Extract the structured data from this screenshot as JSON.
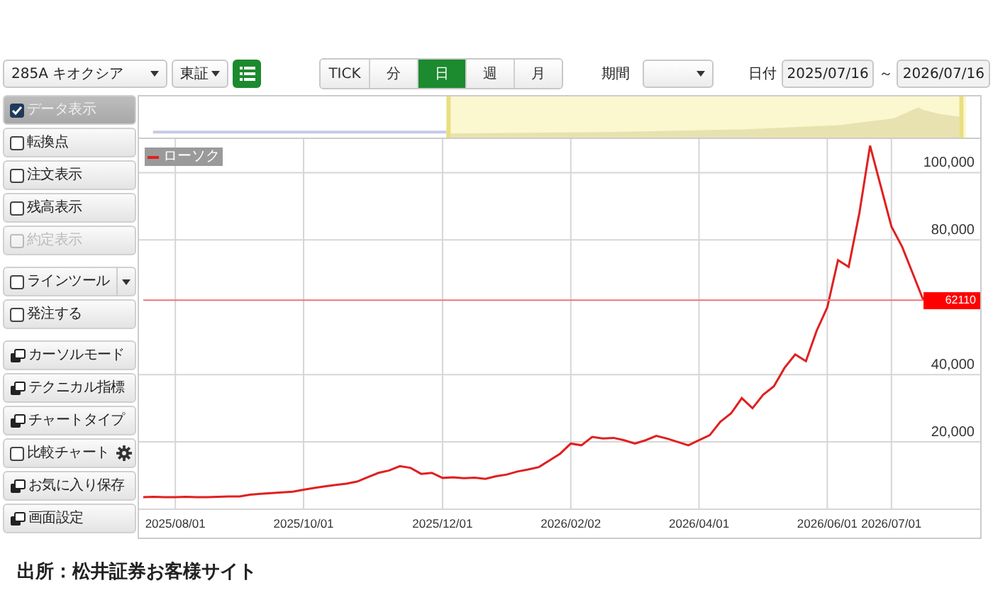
{
  "toolbar": {
    "symbol": "285A キオクシア",
    "market": "東証",
    "intervals": [
      {
        "label": "TICK",
        "selected": false
      },
      {
        "label": "分",
        "selected": false
      },
      {
        "label": "日",
        "selected": true
      },
      {
        "label": "週",
        "selected": false
      },
      {
        "label": "月",
        "selected": false
      }
    ],
    "period_label": "期間",
    "date_label": "日付",
    "date_from": "2025/07/16",
    "date_separator": "～",
    "date_to": "2026/07/16"
  },
  "sidebar": {
    "groups": [
      [
        {
          "kind": "checkbox",
          "label": "データ表示",
          "checked": true,
          "disabled": false,
          "dropdown": false,
          "settings": false
        },
        {
          "kind": "checkbox",
          "label": "転換点",
          "checked": false,
          "disabled": false,
          "dropdown": false,
          "settings": false
        },
        {
          "kind": "checkbox",
          "label": "注文表示",
          "checked": false,
          "disabled": false,
          "dropdown": false,
          "settings": false
        },
        {
          "kind": "checkbox",
          "label": "残高表示",
          "checked": false,
          "disabled": false,
          "dropdown": false,
          "settings": false
        },
        {
          "kind": "checkbox",
          "label": "約定表示",
          "checked": false,
          "disabled": true,
          "dropdown": false,
          "settings": false
        }
      ],
      [
        {
          "kind": "checkbox",
          "label": "ラインツール",
          "checked": false,
          "disabled": false,
          "dropdown": true,
          "settings": false
        },
        {
          "kind": "checkbox",
          "label": "発注する",
          "checked": false,
          "disabled": false,
          "dropdown": false,
          "settings": false
        }
      ],
      [
        {
          "kind": "menu",
          "label": "カーソルモード",
          "dropdown": false,
          "settings": false
        },
        {
          "kind": "menu",
          "label": "テクニカル指標",
          "dropdown": false,
          "settings": false
        },
        {
          "kind": "menu",
          "label": "チャートタイプ",
          "dropdown": false,
          "settings": false
        },
        {
          "kind": "checkbox",
          "label": "比較チャート",
          "checked": false,
          "disabled": false,
          "dropdown": false,
          "settings": true
        },
        {
          "kind": "menu",
          "label": "お気に入り保存",
          "dropdown": false,
          "settings": false
        },
        {
          "kind": "menu",
          "label": "画面設定",
          "dropdown": false,
          "settings": false
        }
      ]
    ]
  },
  "chart": {
    "chart_data": {
      "type": "line",
      "ylim": [
        0,
        110000
      ],
      "grid": true,
      "categories": [
        null,
        null,
        null,
        "2025/08/01",
        null,
        null,
        null,
        null,
        null,
        null,
        null,
        null,
        null,
        null,
        null,
        "2025/10/01",
        null,
        null,
        null,
        null,
        null,
        null,
        null,
        null,
        null,
        null,
        null,
        null,
        "2025/12/01",
        null,
        null,
        null,
        null,
        null,
        null,
        null,
        null,
        null,
        null,
        null,
        "2026/02/02",
        null,
        null,
        null,
        null,
        null,
        null,
        null,
        null,
        null,
        null,
        null,
        "2026/04/01",
        null,
        null,
        null,
        null,
        null,
        null,
        null,
        null,
        null,
        null,
        null,
        "2026/06/01",
        null,
        null,
        null,
        null,
        null,
        "2026/07/01",
        null,
        null,
        null
      ],
      "yticks": [
        {
          "value": 20000,
          "label": "20,000"
        },
        {
          "value": 40000,
          "label": "40,000"
        },
        {
          "value": 80000,
          "label": "80,000"
        },
        {
          "value": 100000,
          "label": "100,000"
        }
      ],
      "series": [
        {
          "name": "ローソク",
          "color": "#e02020",
          "values": [
            3600,
            3700,
            3600,
            3600,
            3700,
            3600,
            3600,
            3700,
            3800,
            3800,
            4300,
            4600,
            4800,
            5000,
            5200,
            5800,
            6300,
            6800,
            7200,
            7600,
            8200,
            9500,
            10800,
            11500,
            12800,
            12300,
            10500,
            10800,
            9300,
            9500,
            9200,
            9400,
            9000,
            9800,
            10300,
            11200,
            11800,
            12500,
            14500,
            16500,
            19500,
            19000,
            21500,
            21000,
            21200,
            20500,
            19500,
            20500,
            21800,
            21000,
            20000,
            19000,
            20500,
            22000,
            26000,
            28500,
            33000,
            30000,
            34000,
            36500,
            42000,
            46000,
            44000,
            53000,
            60000,
            74000,
            72000,
            88000,
            108000,
            96000,
            84000,
            78000,
            70000,
            62000
          ]
        },
        {
          "name": "62110",
          "color": "#e87878",
          "values": [
            62100,
            62100,
            62100,
            62100,
            62100,
            62100,
            62100,
            62100,
            62100,
            62100,
            62100,
            62100,
            62100,
            62100,
            62100,
            62100,
            62100,
            62100,
            62100,
            62100,
            62100,
            62100,
            62100,
            62100,
            62100,
            62100,
            62100,
            62100,
            62100,
            62100,
            62100,
            62100,
            62100,
            62100,
            62100,
            62100,
            62100,
            62100,
            62100,
            62100,
            62100,
            62100,
            62100,
            62100,
            62100,
            62100,
            62100,
            62100,
            62100,
            62100,
            62100,
            62100,
            62100,
            62100,
            62100,
            62100,
            62100,
            62100,
            62100,
            62100,
            62100,
            62100,
            62100,
            62100,
            62100,
            62100,
            62100,
            62100,
            62100,
            62100,
            62100,
            62100,
            62100,
            62100
          ]
        }
      ]
    }
  },
  "source": "出所：松井証券お客様サイト"
}
